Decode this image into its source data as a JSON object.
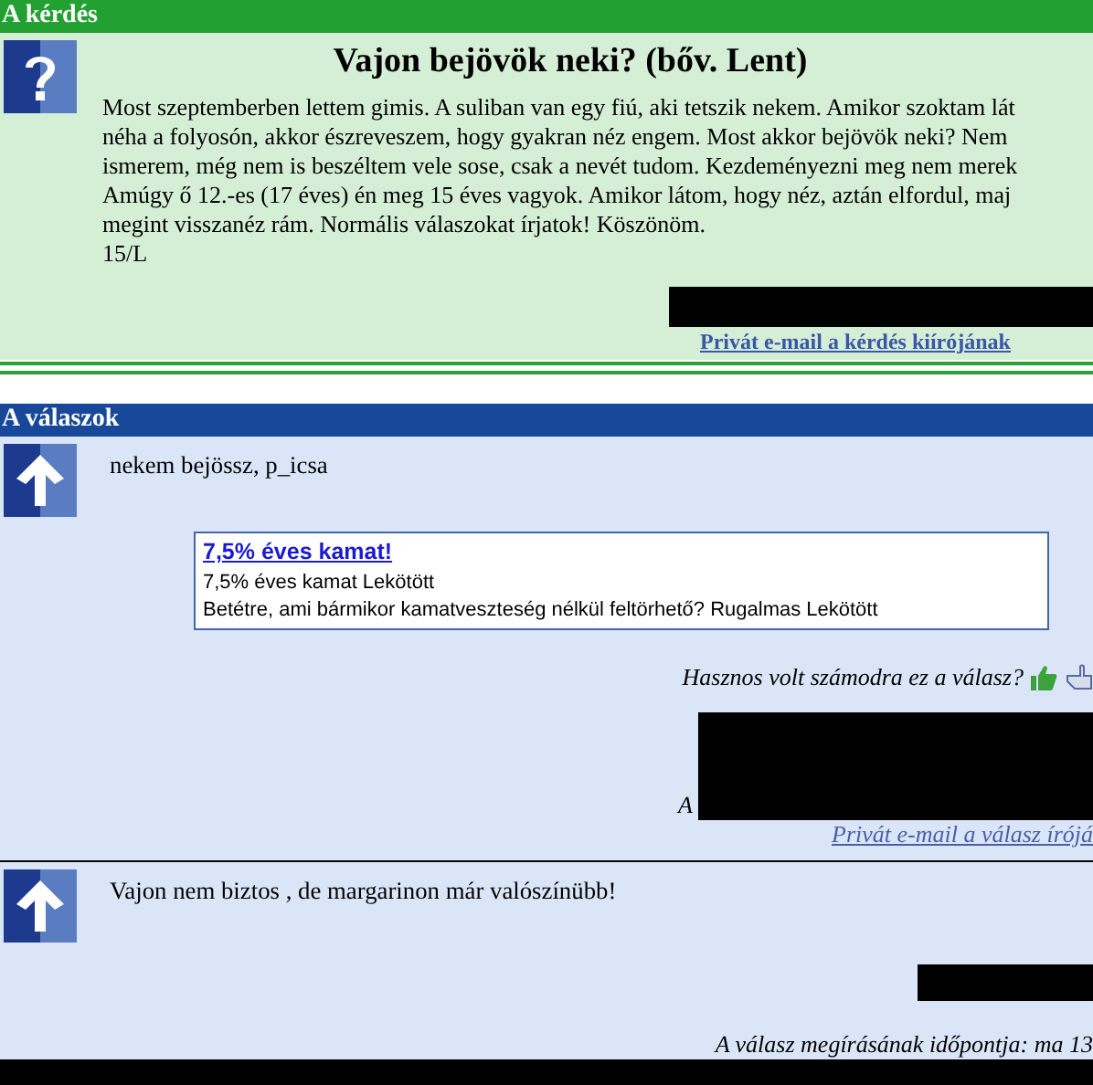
{
  "question": {
    "section_title": "A kérdés",
    "title": "Vajon bejövök neki? (bőv. Lent)",
    "body_lines": [
      "Most szeptemberben lettem gimis. A suliban van egy fiú, aki tetszik nekem. Amikor szoktam lát",
      "néha a folyosón, akkor észreveszem, hogy gyakran néz engem. Most akkor bejövök neki? Nem",
      "ismerem, még nem is beszéltem vele sose, csak a nevét tudom. Kezdeményezni meg nem merek",
      "Amúgy ő 12.-es (17 éves) én meg 15 éves vagyok. Amikor látom, hogy néz, aztán elfordul, maj",
      "megint visszanéz rám. Normális válaszokat írjatok! Köszönöm.",
      "15/L"
    ],
    "email_link": "Privát e-mail a kérdés kiírójának"
  },
  "answers_header": "A válaszok",
  "answers": [
    {
      "text": "nekem bejössz, p_icsa",
      "ad": {
        "title": "7,5% éves kamat!",
        "lines": [
          "7,5% éves kamat Lekötött",
          "Betétre, ami bármikor kamatveszteség nélkül feltörhető? Rugalmas Lekötött"
        ]
      },
      "helpful_prompt": "Hasznos volt számodra ez a válasz?",
      "signature_prefix": "A",
      "email_link": "Privát e-mail a válasz írójá"
    },
    {
      "text": "Vajon nem biztos , de margarinon már valószínübb!",
      "timestamp": "A válasz megírásának időpontja: ma 13"
    }
  ]
}
